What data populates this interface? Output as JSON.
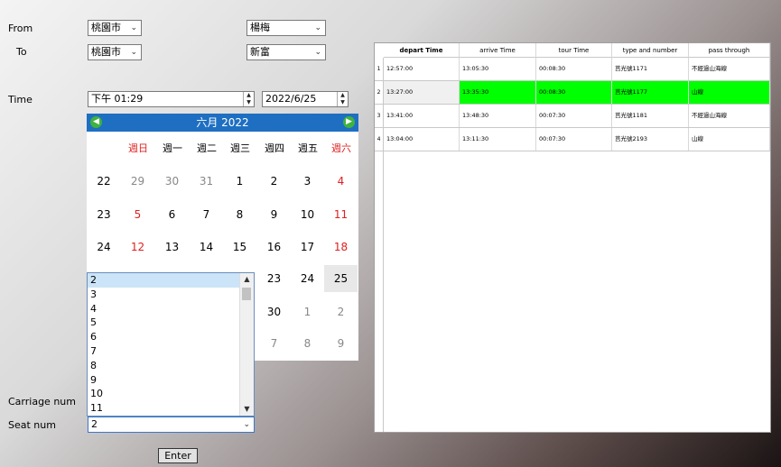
{
  "form": {
    "from_label": "From",
    "to_label": "To",
    "time_label": "Time",
    "carriage_label": "Carriage num",
    "seat_label": "Seat num",
    "from_city": "桃園市",
    "from_station": "楊梅",
    "to_city": "桃園市",
    "to_station": "新富",
    "time_value": "下午 01:29",
    "date_value": "2022/6/25",
    "seat_value": "2",
    "enter_label": "Enter"
  },
  "calendar": {
    "title": "六月  2022",
    "weekdays": [
      "週日",
      "週一",
      "週二",
      "週三",
      "週四",
      "週五",
      "週六"
    ],
    "weeks": [
      {
        "num": "22",
        "days": [
          "29",
          "30",
          "31",
          "1",
          "2",
          "3",
          "4"
        ]
      },
      {
        "num": "23",
        "days": [
          "5",
          "6",
          "7",
          "8",
          "9",
          "10",
          "11"
        ]
      },
      {
        "num": "24",
        "days": [
          "12",
          "13",
          "14",
          "15",
          "16",
          "17",
          "18"
        ]
      },
      {
        "num": "",
        "days": [
          "",
          "",
          "",
          "",
          "23",
          "24",
          "25"
        ]
      },
      {
        "num": "",
        "days": [
          "",
          "",
          "",
          "",
          "30",
          "1",
          "2"
        ]
      },
      {
        "num": "",
        "days": [
          "",
          "",
          "",
          "",
          "7",
          "8",
          "9"
        ]
      }
    ]
  },
  "seat_list": [
    "2",
    "3",
    "4",
    "5",
    "6",
    "7",
    "8",
    "9",
    "10",
    "11"
  ],
  "grid": {
    "headers": [
      "depart Time",
      "arrive Time",
      "tour Time",
      "type and number",
      "pass through"
    ],
    "rows": [
      {
        "idx": "1",
        "cells": [
          "12:57:00",
          "13:05:30",
          "00:08:30",
          "莒光號1171",
          "不經過山海線"
        ]
      },
      {
        "idx": "2",
        "cells": [
          "13:27:00",
          "13:35:30",
          "00:08:30",
          "莒光號1177",
          "山線"
        ]
      },
      {
        "idx": "3",
        "cells": [
          "13:41:00",
          "13:48:30",
          "00:07:30",
          "莒光號1181",
          "不經過山海線"
        ]
      },
      {
        "idx": "4",
        "cells": [
          "13:04:00",
          "13:11:30",
          "00:07:30",
          "莒光號2193",
          "山線"
        ]
      }
    ]
  },
  "colors": {
    "selected_row": "#00ff00",
    "calendar_header": "#1e6fc2",
    "weekend": "#e02020"
  }
}
